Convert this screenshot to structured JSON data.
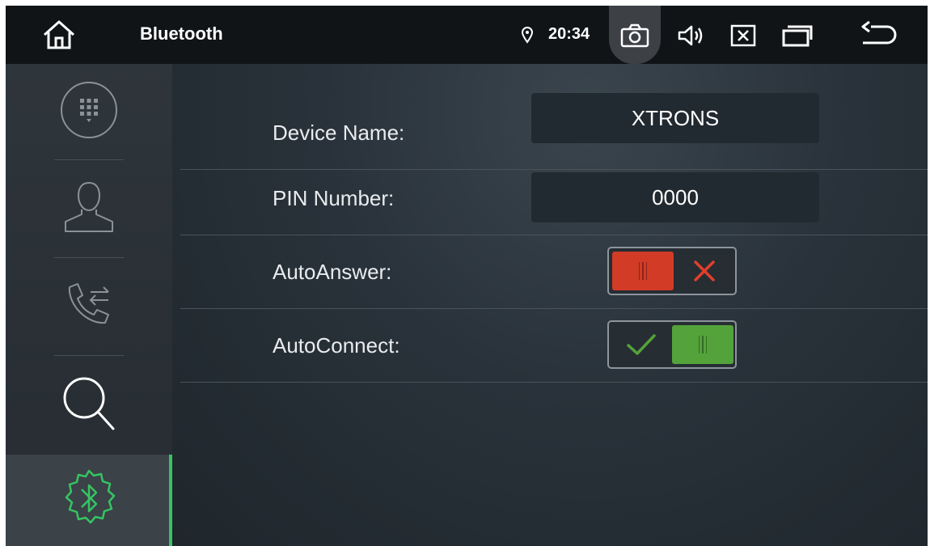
{
  "status_bar": {
    "title": "Bluetooth",
    "time": "20:34",
    "icons": [
      "home-icon",
      "location-icon",
      "camera-icon",
      "volume-icon",
      "close-box-icon",
      "window-icon",
      "back-icon"
    ],
    "camera_highlight_color": "#3d4146"
  },
  "sidebar": {
    "items": [
      {
        "icon": "dialpad-icon"
      },
      {
        "icon": "contacts-icon"
      },
      {
        "icon": "call-log-icon"
      },
      {
        "icon": "search-icon"
      },
      {
        "icon": "bluetooth-settings-icon",
        "active": true
      }
    ],
    "active_color": "#36c463"
  },
  "settings": {
    "device_name_label": "Device Name:",
    "device_name_value": "XTRONS",
    "pin_label": "PIN Number:",
    "pin_value": "0000",
    "auto_answer_label": "AutoAnswer:",
    "auto_answer_on": false,
    "auto_connect_label": "AutoConnect:",
    "auto_connect_on": true
  },
  "colors": {
    "toggle_off": "#d23b26",
    "toggle_on": "#53a33a"
  }
}
